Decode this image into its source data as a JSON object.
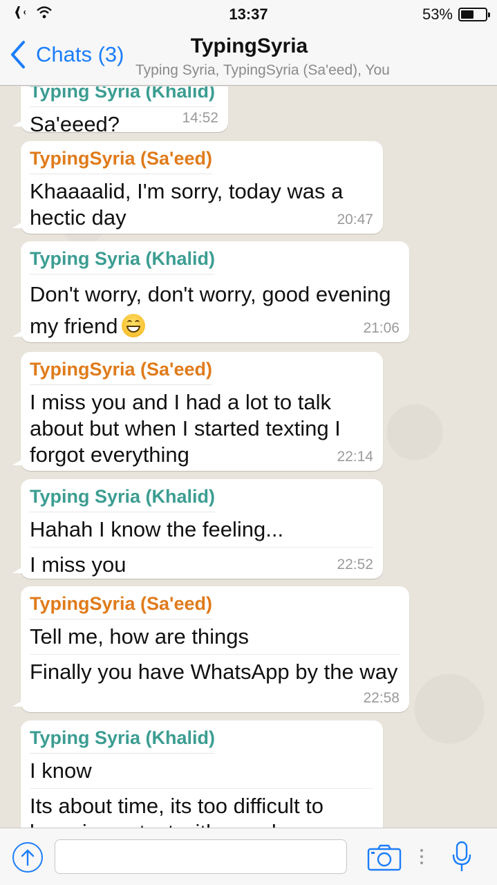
{
  "status_bar": {
    "time": "13:37",
    "battery": "53%",
    "battery_level": 0.53,
    "icons": [
      "airplane-icon",
      "wifi-icon",
      "battery-icon"
    ]
  },
  "nav": {
    "back_label": "Chats (3)",
    "title": "TypingSyria",
    "subtitle": "Typing Syria, TypingSyria (Sa'eed), You"
  },
  "colors": {
    "accent": "#1b7dfa",
    "saeed": "#e07b1b",
    "khalid": "#3c9d92",
    "background": "#e9e4db"
  },
  "messages": [
    {
      "sender": "Typing Syria (Khalid)",
      "lines": [
        "Sa'eeed?"
      ],
      "time": "14:52"
    },
    {
      "sender": "TypingSyria (Sa'eed)",
      "lines": [
        "Khaaaalid, I'm sorry, today was a hectic day"
      ],
      "time": "20:47"
    },
    {
      "sender": "Typing Syria (Khalid)",
      "lines": [
        "Don't worry, don't worry, good evening my friend"
      ],
      "time": "21:06",
      "emoji": "grinning-face-emoji"
    },
    {
      "sender": "TypingSyria (Sa'eed)",
      "lines": [
        "I miss you and I had a lot to talk about but when I started texting I forgot everything"
      ],
      "time": "22:14"
    },
    {
      "sender": "Typing Syria (Khalid)",
      "lines": [
        "Hahah I know the feeling...",
        "I miss you"
      ],
      "time": "22:52"
    },
    {
      "sender": "TypingSyria (Sa'eed)",
      "lines": [
        "Tell me, how are things",
        "Finally you have WhatsApp by the way"
      ],
      "time": "22:58"
    },
    {
      "sender": "Typing Syria (Khalid)",
      "lines": [
        "I know",
        "Its about time, its too difficult to keep in contact with people now"
      ],
      "time": ""
    }
  ],
  "input": {
    "placeholder": "",
    "value": ""
  }
}
